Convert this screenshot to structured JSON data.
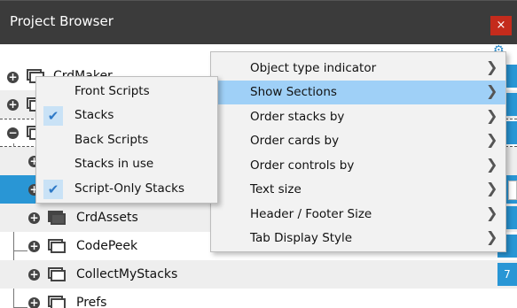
{
  "window": {
    "title": "Project Browser",
    "close_glyph": "×"
  },
  "tree": {
    "rows": [
      {
        "name": "CrdMaker",
        "expander": "+"
      },
      {
        "name": "",
        "expander": "+"
      },
      {
        "name": "",
        "expander": "−"
      },
      {
        "name": "",
        "expander": "+"
      },
      {
        "name": "",
        "expander": "+"
      },
      {
        "name": "CrdAssets",
        "expander": "+"
      },
      {
        "name": "CodePeek",
        "expander": "+"
      },
      {
        "name": "CollectMyStacks",
        "expander": "+",
        "count": "7"
      },
      {
        "name": "Prefs",
        "expander": "+"
      }
    ]
  },
  "stack_menu": {
    "items": [
      {
        "label": "Front Scripts",
        "checked": false
      },
      {
        "label": "Stacks",
        "checked": true
      },
      {
        "label": "Back Scripts",
        "checked": false
      },
      {
        "label": "Stacks in use",
        "checked": false
      },
      {
        "label": "Script-Only Stacks",
        "checked": true
      }
    ],
    "check_glyph": "✔"
  },
  "options_menu": {
    "items": [
      {
        "label": "Object type indicator"
      },
      {
        "label": "Show Sections",
        "highlighted": true
      },
      {
        "label": "Order stacks by"
      },
      {
        "label": "Order cards by"
      },
      {
        "label": "Order controls by"
      },
      {
        "label": "Text size"
      },
      {
        "label": "Header / Footer Size"
      },
      {
        "label": "Tab Display Style"
      }
    ],
    "arrow_glyph": "❯"
  },
  "icons": {
    "gear": "gear-icon",
    "stack": "stack-icon",
    "expand": "plus-circle-icon",
    "collapse": "minus-circle-icon"
  },
  "colors": {
    "titlebar": "#3b3b3b",
    "selection": "#2996d5",
    "menu_highlight": "#9fd0f7",
    "close": "#c42b1c"
  }
}
